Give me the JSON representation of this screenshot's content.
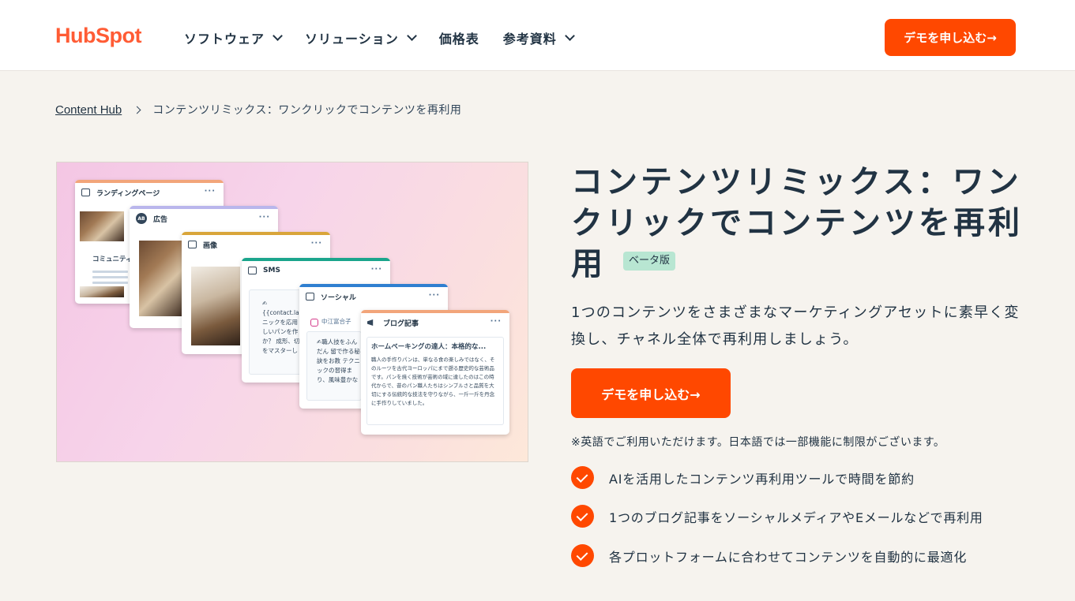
{
  "header": {
    "logo": "HubSpot",
    "nav": [
      {
        "label": "ソフトウェア",
        "has_dropdown": true
      },
      {
        "label": "ソリューション",
        "has_dropdown": true
      },
      {
        "label": "価格表",
        "has_dropdown": false
      },
      {
        "label": "参考資料",
        "has_dropdown": true
      }
    ],
    "cta": "デモを申し込む→"
  },
  "breadcrumb": {
    "parent": "Content Hub",
    "current": "コンテンツリミックス：ワンクリックでコンテンツを再利用"
  },
  "hero_cards": {
    "landing": {
      "title": "ランディングページ",
      "text": "コミュニティ"
    },
    "ad": {
      "title": "広告",
      "avatar": "AB"
    },
    "image": {
      "title": "画像"
    },
    "sms": {
      "title": "SMS",
      "text": "✍{{contact.las ニックを応用 しいパンを作 か？ 成形、切 をマスターし"
    },
    "social": {
      "title": "ソーシャル",
      "account": "中江富合子",
      "text": "✍職人技をふんだん 留で作る秘訣をお教 テクニックの習得ま り、風味豊かなパン アーティザンブレッ"
    },
    "blog": {
      "title": "ブログ記事",
      "heading": "ホームベーキングの達人：本格的な...",
      "body": "職人の手作りパンは、単なる食の楽しみではなく、そのルーツを古代ヨーロッパにまで遡る歴史的な芸術品です。パンを焼く技術が芸術の域に達したのはこの時代からで、昔のパン職人たちはシンプルさと品質を大切にする伝統的な技法を守りながら、一斤一斤を丹念に手作りしていました。"
    }
  },
  "main": {
    "title": "コンテンツリミックス：ワンクリックでコンテンツを再利用",
    "badge": "ベータ版",
    "description": "1つのコンテンツをさまざまなマーケティングアセットに素早く変換し、チャネル全体で再利用しましょう。",
    "cta": "デモを申し込む→",
    "note": "※英語でご利用いただけます。日本語では一部機能に制限がございます。",
    "features": [
      "AIを活用したコンテンツ再利用ツールで時間を節約",
      "1つのブログ記事をソーシャルメディアやEメールなどで再利用",
      "各プロットフォームに合わせてコンテンツを自動的に最適化"
    ]
  },
  "colors": {
    "brand_orange": "#ff4800",
    "logo_orange": "#ff5c35",
    "text_dark": "#213343",
    "badge_green": "#b8e6d2",
    "page_bg": "#f6f3ee"
  }
}
